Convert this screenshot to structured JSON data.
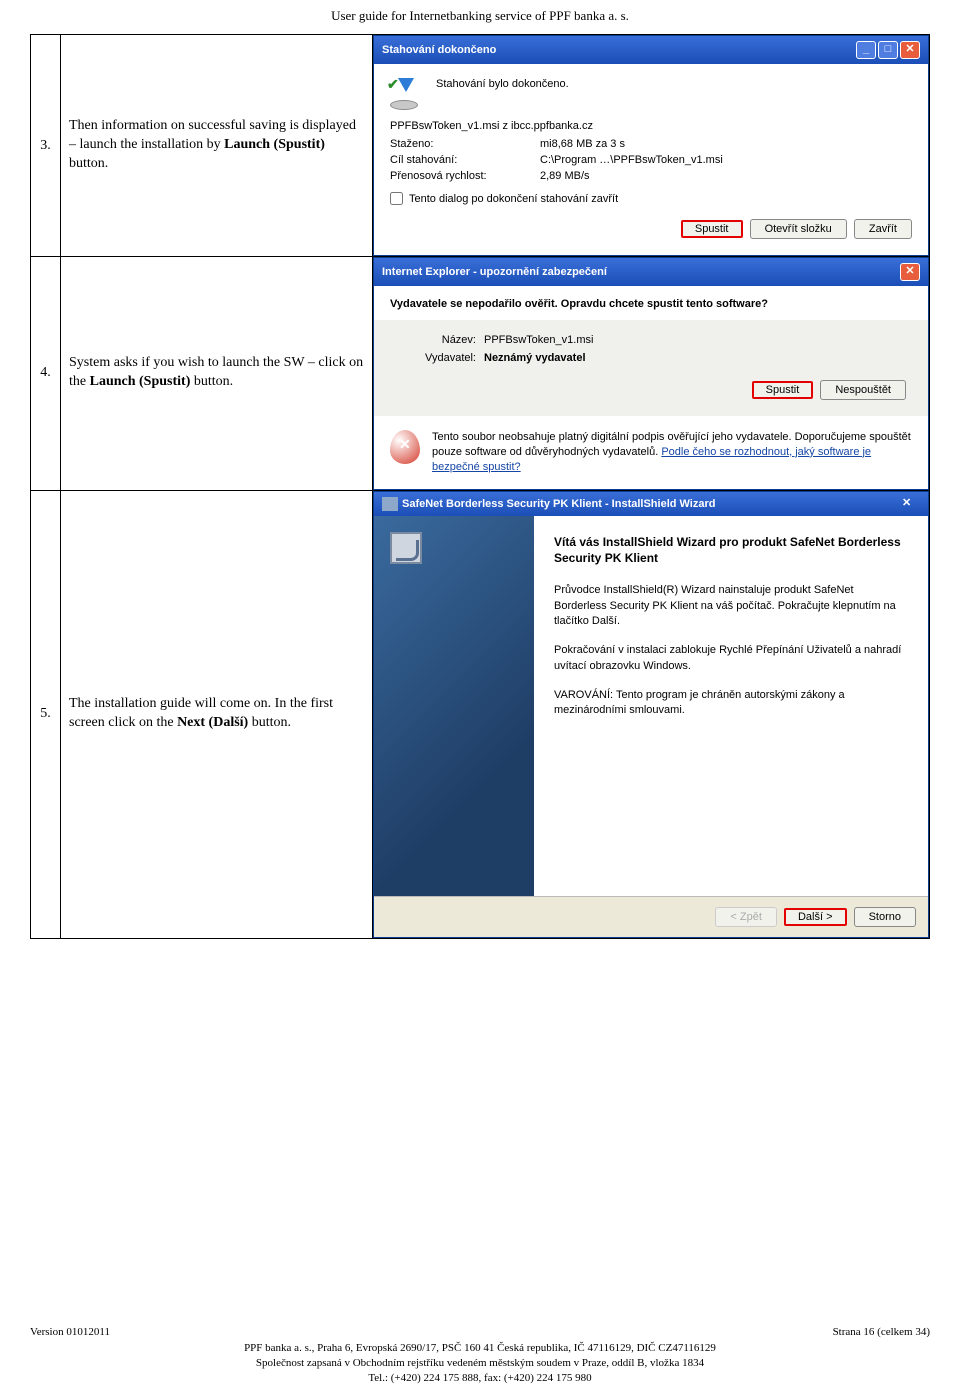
{
  "page_header": "User guide for Internetbanking service of PPF banka a. s.",
  "rows": [
    {
      "num": "3.",
      "desc_a": "Then information on successful saving is displayed – launch the installation by ",
      "desc_bold": "Launch (Spustit)",
      "desc_b": " button."
    },
    {
      "num": "4.",
      "desc_a": "System asks if you wish to launch the SW – click on the ",
      "desc_bold": "Launch (Spustit)",
      "desc_b": " button."
    },
    {
      "num": "5.",
      "desc_a": "The installation guide will come on. In the first screen click on the ",
      "desc_bold": "Next (Další)",
      "desc_b": "  button."
    }
  ],
  "dialog1": {
    "title": "Stahování dokončeno",
    "done_msg": "Stahování bylo dokončeno.",
    "file_line": "PPFBswToken_v1.msi z ibcc.ppfbanka.cz",
    "lbl_stazeno": "Staženo:",
    "val_stazeno": "mi8,68 MB za 3 s",
    "lbl_cil": "Cíl stahování:",
    "val_cil": "C:\\Program …\\PPFBswToken_v1.msi",
    "lbl_rychlost": "Přenosová rychlost:",
    "val_rychlost": "2,89 MB/s",
    "chk": "Tento dialog po dokončení stahování zavřít",
    "btn_run": "Spustit",
    "btn_openfolder": "Otevřít složku",
    "btn_close": "Zavřít"
  },
  "dialog2": {
    "title": "Internet Explorer - upozornění zabezpečení",
    "header": "Vydavatele se nepodařilo ověřit. Opravdu chcete spustit tento software?",
    "lbl_name": "Název:",
    "val_name": "PPFBswToken_v1.msi",
    "lbl_pub": "Vydavatel:",
    "val_pub": "Neznámý vydavatel",
    "btn_run": "Spustit",
    "btn_dontrun": "Nespouštět",
    "foot_a": "Tento soubor neobsahuje platný digitální podpis ověřující jeho vydavatele. Doporučujeme spouštět pouze software od důvěryhodných vydavatelů. ",
    "foot_link": "Podle čeho se rozhodnout, jaký software je bezpečné spustit?"
  },
  "dialog3": {
    "title": "SafeNet Borderless Security PK Klient - InstallShield Wizard",
    "welcome": "Vítá vás InstallShield Wizard pro produkt SafeNet Borderless Security PK Klient",
    "p1": "Průvodce InstallShield(R) Wizard nainstaluje produkt SafeNet Borderless Security PK Klient na váš počítač. Pokračujte klepnutím na tlačítko Další.",
    "p2": "Pokračování v instalaci zablokuje Rychlé Přepínání Uživatelů a nahradí uvítací obrazovku Windows.",
    "p3": "VAROVÁNÍ: Tento program je chráněn autorskými zákony a mezinárodními smlouvami.",
    "btn_back": "< Zpět",
    "btn_next": "Další >",
    "btn_cancel": "Storno"
  },
  "footer": {
    "version": "Version 01012011",
    "pages": "Strana 16 (celkem 34)",
    "line1": "PPF banka a. s., Praha 6, Evropská 2690/17, PSČ 160 41 Česká republika, IČ 47116129, DIČ CZ47116129",
    "line2": "Společnost zapsaná v Obchodním rejstříku vedeném městským soudem v Praze, oddíl B, vložka 1834",
    "line3": "Tel.: (+420) 224 175 888, fax: (+420) 224 175 980"
  }
}
